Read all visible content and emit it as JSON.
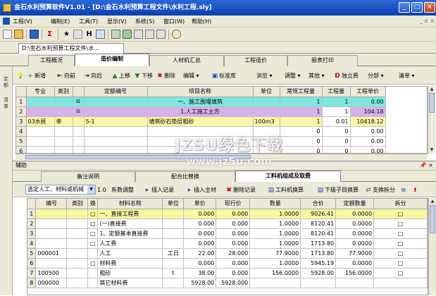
{
  "window": {
    "title": "金石水利预算软件V1.01 - [D:\\金石水利预算工程文件\\水利工程.sly]",
    "min": "_",
    "max": "□",
    "close": "×"
  },
  "menu": [
    "工程(V)",
    "编制(E)",
    "工具(T)",
    "显示(V)",
    "系统(S)",
    "窗口(W)",
    "帮助(H)"
  ],
  "toolbar_glyphs": {
    "sigma": "Σ",
    "star": "★",
    "h": "H"
  },
  "doc_tab": "D:\\金石水利预算工程文件\\水...",
  "main_tabs": [
    "工程概况",
    "造价编制",
    "人材机汇总",
    "工程造价",
    "报表打印"
  ],
  "left_vtabs": [
    "定额",
    "清单"
  ],
  "edit_toolbar": [
    "新增",
    "向前",
    "向后",
    "上移",
    "下移",
    "删除",
    "编辑",
    "标准库",
    "浏览",
    "调整",
    "其他",
    "独立费",
    "分部",
    "清单"
  ],
  "upper_grid": {
    "headers": [
      "",
      "专业",
      "类别",
      "",
      "定额编号",
      "项目名称",
      "单位",
      "常规工程量",
      "工程量",
      "工程单价"
    ],
    "rows": [
      {
        "n": "1",
        "zy": "",
        "lb": "",
        "tree": "⊟",
        "code": "",
        "name": "一、施工围堰填筑",
        "unit": "",
        "cg": "1",
        "gcl": "1",
        "dj": "0.00"
      },
      {
        "n": "2",
        "zy": "",
        "lb": "",
        "tree": "⊟",
        "code": "",
        "name": "1.人工施工土方",
        "unit": "",
        "cg": "1",
        "gcl": "1",
        "dj": "104.18"
      },
      {
        "n": "3",
        "zy": "03水抚",
        "lb": "单",
        "tree": "",
        "code": "5-1",
        "name": "填筑砂石垫层粗砂",
        "unit": "100m3",
        "cg": "1",
        "gcl": "0.01",
        "dj": "10418.12"
      },
      {
        "n": "4",
        "zy": "",
        "lb": "",
        "tree": "",
        "code": "",
        "name": "",
        "unit": "",
        "cg": "0",
        "gcl": "0",
        "dj": "0.00"
      },
      {
        "n": "5",
        "zy": "",
        "lb": "",
        "tree": "",
        "code": "",
        "name": "",
        "unit": "",
        "cg": "0",
        "gcl": "0",
        "dj": "0.00"
      },
      {
        "n": "6",
        "zy": "",
        "lb": "",
        "tree": "",
        "code": "",
        "name": "",
        "unit": "",
        "cg": "0",
        "gcl": "0",
        "dj": "0.00"
      }
    ]
  },
  "aux_label": "辅助",
  "aux_tabs": [
    "备注说明",
    "配合比替换",
    "工料机组成及取费"
  ],
  "aux_toolbar": {
    "combo": "选定人工、材料或机械",
    "qty": "1.0",
    "items": [
      "系数调整",
      "插入记录",
      "插入主材",
      "删除记录",
      "工料机换算",
      "下级子目换算",
      "支换拆分"
    ]
  },
  "lower_grid": {
    "headers": [
      "",
      "编号",
      "类别",
      "换",
      "材料名称",
      "单位",
      "单价",
      "现行价",
      "数量",
      "合价",
      "定额数量",
      "拆分"
    ],
    "rows": [
      {
        "n": "1",
        "bh": "",
        "lb": "",
        "h": "□",
        "name": "一、直接工程费",
        "unit": "",
        "dj": "0.000",
        "xx": "0.000",
        "sl": "1.0000",
        "hj": "9026.41",
        "de": "0.0000",
        "cf": "□"
      },
      {
        "n": "2",
        "bh": "",
        "lb": "",
        "h": "□",
        "name": "(一)直接费",
        "unit": "",
        "dj": "0.000",
        "xx": "0.000",
        "sl": "1.0000",
        "hj": "8120.41",
        "de": "0.0000",
        "cf": "□"
      },
      {
        "n": "3",
        "bh": "",
        "lb": "",
        "h": "□",
        "name": "1、定额基本直接费",
        "unit": "",
        "dj": "0.000",
        "xx": "0.000",
        "sl": "1.0000",
        "hj": "8120.41",
        "de": "0.0000",
        "cf": "□"
      },
      {
        "n": "4",
        "bh": "",
        "lb": "",
        "h": "□",
        "name": "人工费",
        "unit": "",
        "dj": "0.000",
        "xx": "0.000",
        "sl": "1.0000",
        "hj": "1713.80",
        "de": "0.0000",
        "cf": "□"
      },
      {
        "n": "5",
        "bh": "000001",
        "lb": "",
        "h": "",
        "name": "人工",
        "unit": "工日",
        "dj": "22.00",
        "xx": "28.000",
        "sl": "77.9000",
        "hj": "1713.80",
        "de": "77.9000",
        "cf": "□"
      },
      {
        "n": "6",
        "bh": "",
        "lb": "",
        "h": "□",
        "name": "材料费",
        "unit": "",
        "dj": "0.000",
        "xx": "0.000",
        "sl": "1.0000",
        "hj": "5945.19",
        "de": "0.0000",
        "cf": "□"
      },
      {
        "n": "7",
        "bh": "100500",
        "lb": "",
        "h": "",
        "name": "粗砂",
        "unit": "t",
        "dj": "38.00",
        "xx": "0.000",
        "sl": "156.0000",
        "hj": "5928.00",
        "de": "156.0000",
        "cf": "□"
      },
      {
        "n": "8",
        "bh": "000000",
        "lb": "",
        "h": "",
        "name": "其它材料费",
        "unit": "",
        "dj": "5928.00",
        "xx": "5928.000",
        "sl": "",
        "hj": "",
        "de": "",
        "cf": ""
      }
    ]
  },
  "watermark": {
    "line1": "JZSU绿色下载",
    "line2": "www.jz5u.com"
  },
  "colors": {
    "title": "#0a3fb0",
    "chrome": "#ece9d8",
    "cyan_row": "#7de7e0",
    "purple_row": "#d8b0ea",
    "yellow_row": "#fbf6a8"
  }
}
